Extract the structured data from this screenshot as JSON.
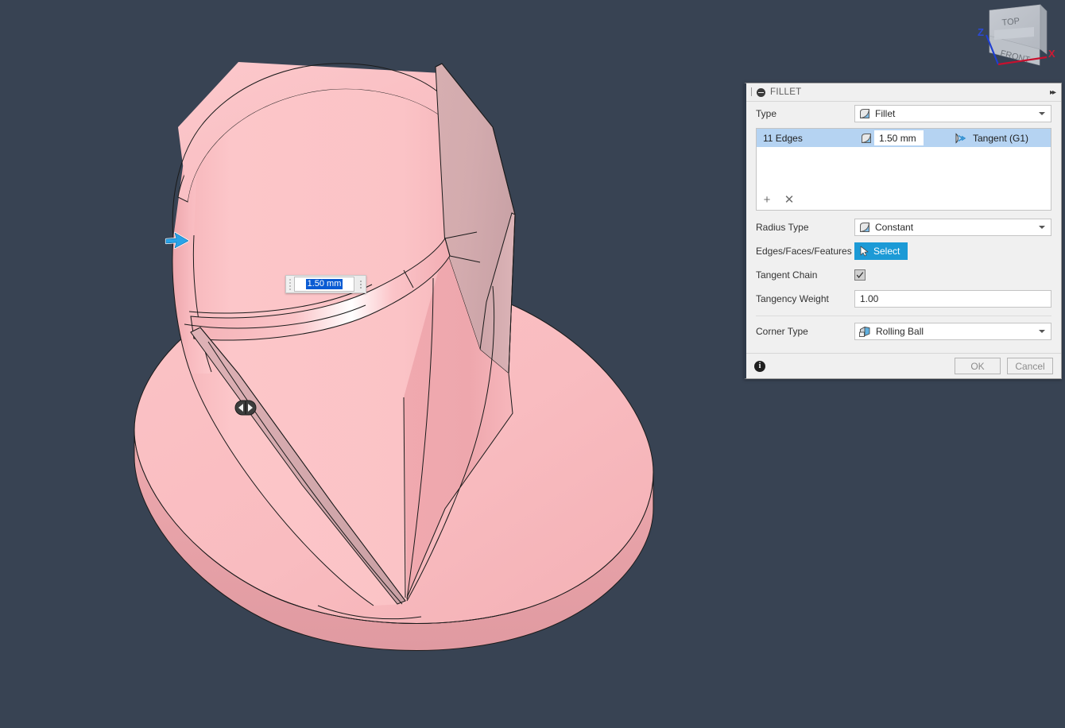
{
  "app": {
    "background_color": "#384353",
    "model_color": "#f8b8bb"
  },
  "viewcube": {
    "top_face_label": "TOP",
    "front_face_label": "FRONT",
    "axis_x_label": "X",
    "axis_z_label": "Z",
    "axis_x_color": "#c8102e",
    "axis_z_color": "#1f3fd0"
  },
  "canvas_input": {
    "value": "1.50 mm",
    "grip_icon": "drag-grip-icon",
    "menu_icon": "more-options-icon"
  },
  "manipulators": {
    "arrow_icon": "blue-arrow-manipulator-icon",
    "slider_icon": "double-arrow-slider-handle-icon"
  },
  "dialog": {
    "title": "FILLET",
    "grip_icon": "dialog-grip-icon",
    "collapse_icon": "collapse-icon",
    "expand_icon": "expand-right-icon",
    "type": {
      "label": "Type",
      "value": "Fillet",
      "icon": "fillet-icon",
      "caret_icon": "chevron-down-icon"
    },
    "edges_list": {
      "rows": [
        {
          "name": "11 Edges",
          "radius": "1.50 mm",
          "radius_icon": "fillet-icon",
          "continuity": "Tangent (G1)",
          "continuity_icon": "tangent-g1-icon",
          "selected": true
        }
      ],
      "add_icon": "plus-icon",
      "remove_icon": "close-x-icon",
      "highlight_color": "#b5d3f2"
    },
    "radius_type": {
      "label": "Radius Type",
      "value": "Constant",
      "icon": "constant-radius-icon",
      "caret_icon": "chevron-down-icon"
    },
    "selection": {
      "label": "Edges/Faces/Features",
      "button_label": "Select",
      "button_icon": "cursor-arrow-icon",
      "button_color": "#1c9ad6"
    },
    "tangent_chain": {
      "label": "Tangent Chain",
      "checked": true,
      "check_icon": "checkmark-icon"
    },
    "tangency_weight": {
      "label": "Tangency Weight",
      "value": "1.00"
    },
    "corner_type": {
      "label": "Corner Type",
      "value": "Rolling Ball",
      "icon": "rolling-ball-icon",
      "caret_icon": "chevron-down-icon"
    },
    "footer": {
      "info_icon": "info-icon",
      "info_glyph": "i",
      "ok_label": "OK",
      "cancel_label": "Cancel"
    }
  }
}
